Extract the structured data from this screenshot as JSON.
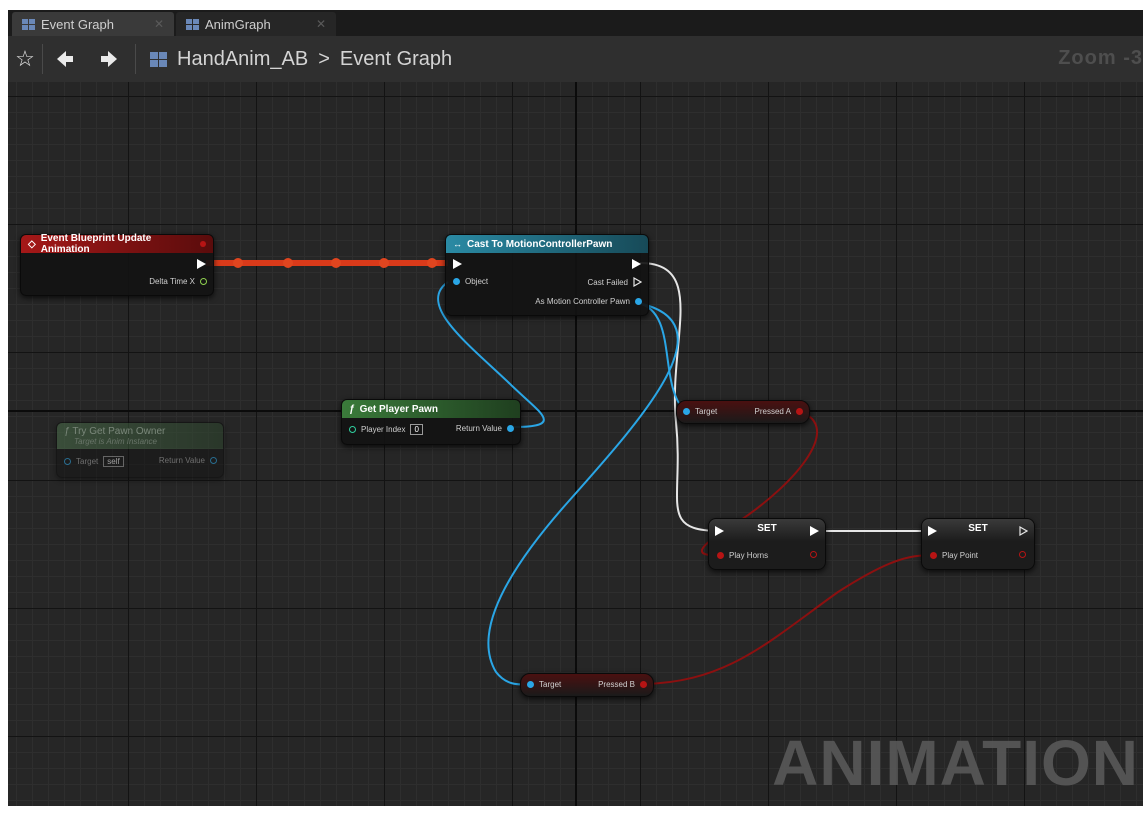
{
  "tabs": [
    {
      "label": "Event Graph",
      "icon": "event-graph-icon"
    },
    {
      "label": "AnimGraph",
      "icon": "anim-graph-icon"
    }
  ],
  "toolbar": {
    "breadcrumb_asset": "HandAnim_AB",
    "breadcrumb_separator": ">",
    "breadcrumb_graph": "Event Graph",
    "zoom": "Zoom -3"
  },
  "nodes": {
    "event_update": {
      "title": "Event Blueprint Update Animation",
      "pin_delta": "Delta Time X"
    },
    "cast": {
      "title": "Cast To MotionControllerPawn",
      "pin_object": "Object",
      "pin_cast_failed": "Cast Failed",
      "pin_as_pawn": "As Motion Controller Pawn"
    },
    "get_player_pawn": {
      "title": "Get Player Pawn",
      "pin_player_index": "Player Index",
      "player_index_value": "0",
      "pin_return": "Return Value"
    },
    "try_get_pawn_owner": {
      "title": "Try Get Pawn Owner",
      "subtitle": "Target is Anim Instance",
      "pin_target": "Target",
      "target_value": "self",
      "pin_return": "Return Value"
    },
    "get_pressed_a": {
      "pin_target": "Target",
      "pin_value": "Pressed A"
    },
    "get_pressed_b": {
      "pin_target": "Target",
      "pin_value": "Pressed B"
    },
    "set_horns": {
      "title": "SET",
      "pin_var": "Play Horns"
    },
    "set_point": {
      "title": "SET",
      "pin_var": "Play Point"
    }
  },
  "watermark": "ANIMATION",
  "colors": {
    "event_header": "#8e1414",
    "cast_header": "#1f6f86",
    "pure_func_header": "#2f5a2f",
    "exec_wire": "#e9e9e9",
    "object_wire": "#2aa6e6",
    "bool_wire": "#8c1010"
  }
}
